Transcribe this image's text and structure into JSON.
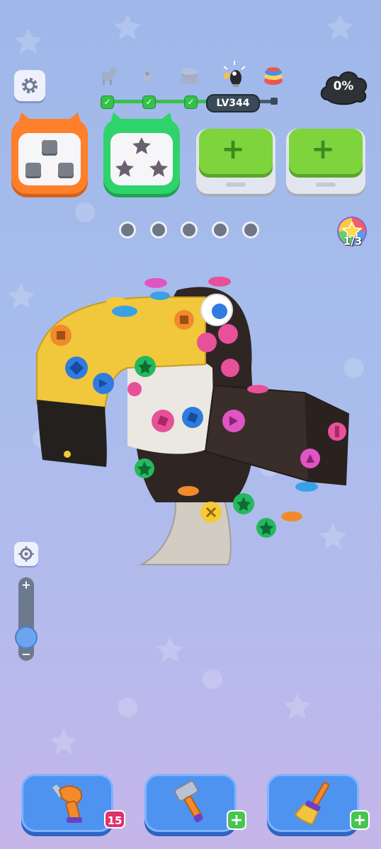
{
  "header": {
    "level_label": "LV344",
    "progress_percent": "0%",
    "stages": [
      {
        "icon": "zebra-icon",
        "completed": true
      },
      {
        "icon": "rocket-icon",
        "completed": true
      },
      {
        "icon": "cake-stack-icon",
        "completed": true
      },
      {
        "icon": "toucan-icon",
        "current": true
      },
      {
        "icon": "macaron-icon",
        "completed": false
      }
    ]
  },
  "boxes": [
    {
      "color": "#ff7f2a",
      "slot_shape": "square",
      "slots": 3
    },
    {
      "color": "#2fd36b",
      "slot_shape": "star",
      "slots": 3
    },
    {
      "type": "add",
      "label": "+"
    },
    {
      "type": "add",
      "label": "+"
    }
  ],
  "holding_slots": 5,
  "star_badge": {
    "count": "1/3"
  },
  "zoom": {
    "plus": "+",
    "minus": "−"
  },
  "tools": [
    {
      "name": "drill",
      "badge": "15"
    },
    {
      "name": "hammer",
      "badge": "+"
    },
    {
      "name": "broom",
      "badge": "+"
    }
  ]
}
